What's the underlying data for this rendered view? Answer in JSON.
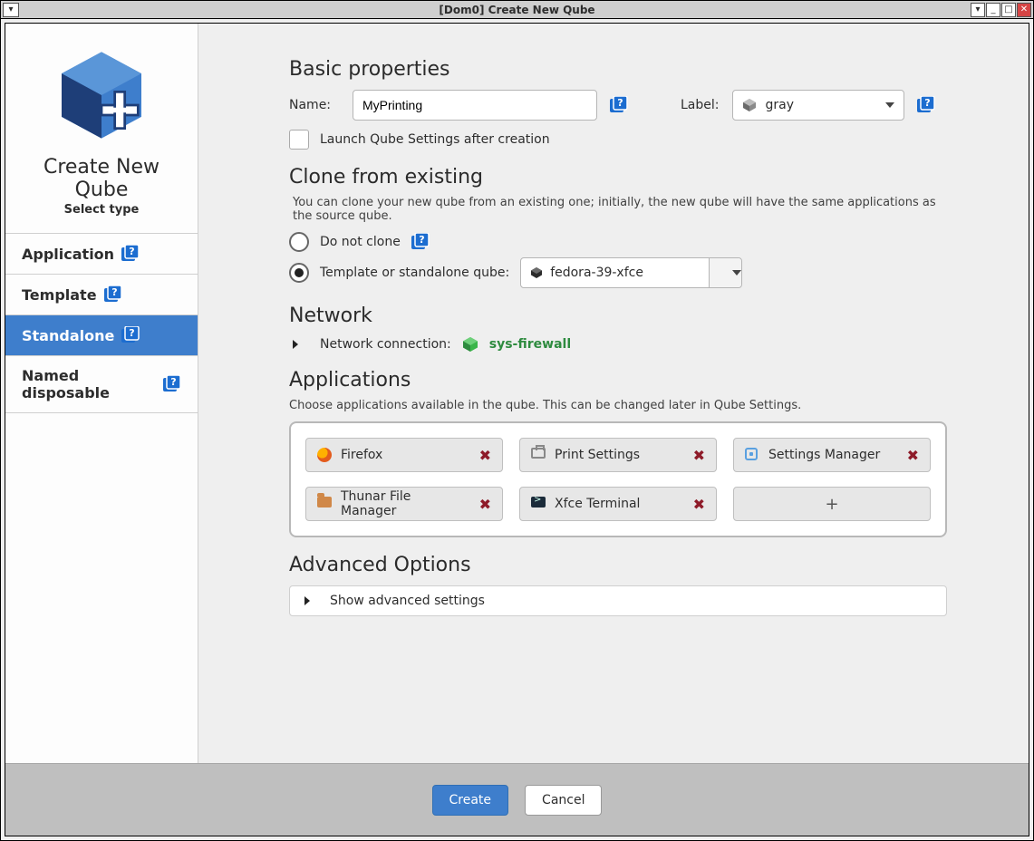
{
  "window": {
    "title": "[Dom0] Create New Qube",
    "buttons": {
      "min_all": "▾",
      "min": "_",
      "max": "□",
      "close": "✕",
      "sysmenu": "▾"
    }
  },
  "sidebar": {
    "hero_title": "Create New Qube",
    "hero_sub": "Select type",
    "types": [
      {
        "label": "Application",
        "selected": false
      },
      {
        "label": "Template",
        "selected": false
      },
      {
        "label": "Standalone",
        "selected": true
      },
      {
        "label": "Named disposable",
        "selected": false
      }
    ]
  },
  "basic": {
    "heading": "Basic properties",
    "name_label": "Name:",
    "name_value": "MyPrinting",
    "label_label": "Label:",
    "label_value": "gray",
    "launch_settings_label": "Launch Qube Settings after creation",
    "launch_settings_checked": false
  },
  "clone": {
    "heading": "Clone from existing",
    "hint": "You can clone your new qube from an existing one; initially, the new qube will have the same applications as the source qube.",
    "option_none": "Do not clone",
    "option_from": "Template or standalone qube:",
    "selected_option": "from",
    "source_value": "fedora-39-xfce"
  },
  "network": {
    "heading": "Network",
    "label": "Network connection:",
    "value": "sys-firewall"
  },
  "apps": {
    "heading": "Applications",
    "hint": "Choose applications available in the qube. This can be changed later in Qube Settings.",
    "items": [
      {
        "name": "Firefox",
        "icon": "firefox"
      },
      {
        "name": "Print Settings",
        "icon": "print"
      },
      {
        "name": "Settings Manager",
        "icon": "settings"
      },
      {
        "name": "Thunar File Manager",
        "icon": "folder"
      },
      {
        "name": "Xfce Terminal",
        "icon": "terminal"
      }
    ],
    "add_label": "+"
  },
  "advanced": {
    "heading": "Advanced Options",
    "toggle_label": "Show advanced settings"
  },
  "footer": {
    "create": "Create",
    "cancel": "Cancel"
  },
  "help_glyph": "?"
}
